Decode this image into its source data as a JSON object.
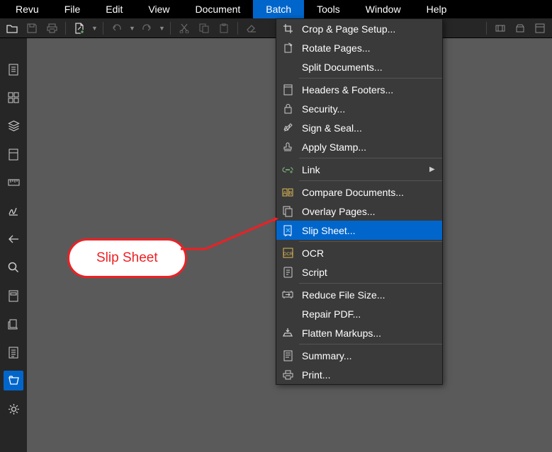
{
  "menubar": {
    "items": [
      "Revu",
      "File",
      "Edit",
      "View",
      "Document",
      "Batch",
      "Tools",
      "Window",
      "Help"
    ],
    "active_index": 5
  },
  "dropdown": {
    "groups": [
      [
        {
          "icon": "crop-icon",
          "label": "Crop & Page Setup..."
        },
        {
          "icon": "rotate-icon",
          "label": "Rotate Pages..."
        },
        {
          "icon": "split-icon",
          "label": "Split Documents..."
        }
      ],
      [
        {
          "icon": "header-icon",
          "label": "Headers & Footers..."
        },
        {
          "icon": "lock-icon",
          "label": "Security..."
        },
        {
          "icon": "sign-icon",
          "label": "Sign & Seal..."
        },
        {
          "icon": "stamp-icon",
          "label": "Apply Stamp..."
        }
      ],
      [
        {
          "icon": "link-icon",
          "label": "Link",
          "submenu": true
        }
      ],
      [
        {
          "icon": "compare-icon",
          "label": "Compare Documents..."
        },
        {
          "icon": "overlay-icon",
          "label": "Overlay Pages..."
        },
        {
          "icon": "slipsheet-icon",
          "label": "Slip Sheet...",
          "highlighted": true
        }
      ],
      [
        {
          "icon": "ocr-icon",
          "label": "OCR"
        },
        {
          "icon": "script-icon",
          "label": "Script"
        }
      ],
      [
        {
          "icon": "reduce-icon",
          "label": "Reduce File Size..."
        },
        {
          "icon": "repair-icon",
          "label": "Repair PDF..."
        },
        {
          "icon": "flatten-icon",
          "label": "Flatten Markups..."
        }
      ],
      [
        {
          "icon": "summary-icon",
          "label": "Summary..."
        },
        {
          "icon": "print-icon",
          "label": "Print..."
        }
      ]
    ]
  },
  "callout": {
    "text": "Slip Sheet"
  }
}
